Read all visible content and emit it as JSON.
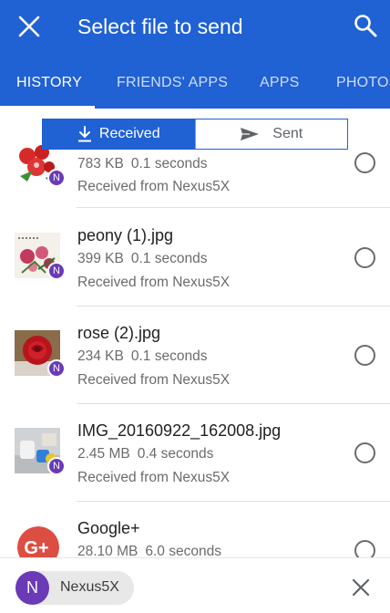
{
  "appbar": {
    "title": "Select file to send",
    "color": "#2061d3",
    "close_icon": "close-icon",
    "search_icon": "search-icon"
  },
  "tabs": [
    {
      "label": "HISTORY",
      "active": true
    },
    {
      "label": "FRIENDS' APPS",
      "active": false
    },
    {
      "label": "APPS",
      "active": false
    },
    {
      "label": "PHOTOS",
      "active": false
    }
  ],
  "segment": {
    "received_label": "Received",
    "sent_label": "Sent",
    "selected": "Received"
  },
  "files": [
    {
      "name": "",
      "size": "783 KB",
      "duration": "0.1 seconds",
      "source": "Received from Nexus5X",
      "badge": "N",
      "thumb": "red-flower"
    },
    {
      "name": "peony (1).jpg",
      "size": "399 KB",
      "duration": "0.1 seconds",
      "source": "Received from Nexus5X",
      "badge": "N",
      "thumb": "peony-painting"
    },
    {
      "name": "rose (2).jpg",
      "size": "234 KB",
      "duration": "0.1 seconds",
      "source": "Received from Nexus5X",
      "badge": "N",
      "thumb": "red-rose"
    },
    {
      "name": "IMG_20160922_162008.jpg",
      "size": "2.45 MB",
      "duration": "0.4 seconds",
      "source": "Received from Nexus5X",
      "badge": "N",
      "thumb": "desk-photo"
    },
    {
      "name": "Google+",
      "size": "28.10 MB",
      "duration": "6.0 seconds",
      "source": "",
      "badge": "",
      "thumb": "google-plus-icon"
    }
  ],
  "bottom": {
    "device_initial": "N",
    "device_name": "Nexus5X",
    "dismiss_icon": "close-icon"
  }
}
